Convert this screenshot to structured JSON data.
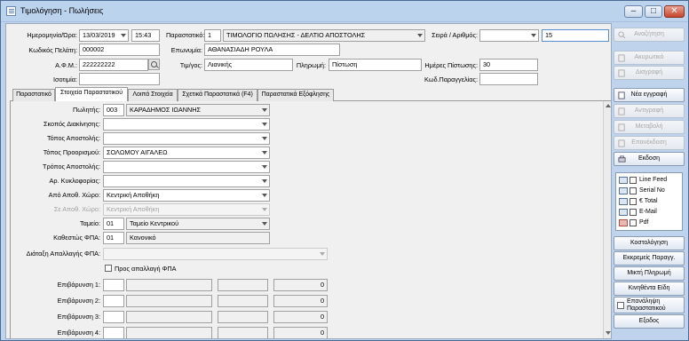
{
  "window": {
    "title": "Τιμολόγηση - Πωλήσεις"
  },
  "header": {
    "date_label": "Ημερομηνία/Ώρα:",
    "date": "13/03/2019",
    "time": "15:43",
    "doc_label": "Παραστατικό:",
    "doc_code": "1",
    "doc_name": "ΤΙΜΟΛΟΓΙΟ ΠΩΛΗΣΗΣ - ΔΕΛΤΙΟ ΑΠΟΣΤΟΛΗΣ",
    "series_label": "Σειρά / Αριθμός:",
    "series_value": "",
    "number_value": "15",
    "customer_code_label": "Κωδικός Πελάτη:",
    "customer_code": "000002",
    "name_label": "Επωνυμία:",
    "name": "ΑΘΑΝΑΣΙΑΔΗ ΡΟΥΛΑ",
    "afm_label": "Α.Φ.Μ.:",
    "afm": "222222222",
    "pricelist_label": "Τιμ/γος:",
    "pricelist": "Λιανικής",
    "payment_label": "Πληρωμή:",
    "payment": "Πίστωση",
    "credit_days_label": "Ημέρες Πίστωσης:",
    "credit_days": "30",
    "balance_label": "Ισοτιμία:",
    "balance": "",
    "order_code_label": "Κωδ.Παραγγελίας:",
    "order_code": ""
  },
  "tabs": [
    {
      "label": "Παραστατικό"
    },
    {
      "label": "Στοιχεία Παραστατικού"
    },
    {
      "label": "Λοιπά Στοιχεία"
    },
    {
      "label": "Σχετικά Παραστατικά (F4)"
    },
    {
      "label": "Παραστατικά Εξόφλησης"
    }
  ],
  "panel": {
    "salesman_label": "Πωλητής:",
    "salesman_code": "003",
    "salesman_name": "ΚΑΡΑΔΗΜΟΣ ΙΩΑΝΝΗΣ",
    "purpose_label": "Σκοπός Διακίνησης:",
    "purpose": "",
    "shipping_place_label": "Τόπος Αποστολής:",
    "shipping_place": "",
    "destination_label": "Τόπος Προορισμού:",
    "destination": "ΣΟΛΩΜΟΥ ΑΙΓΑΛΕΩ",
    "shipping_method_label": "Τρόπος Αποστολής:",
    "shipping_method": "",
    "vehicle_label": "Αρ. Κυκλοφορίας:",
    "vehicle": "",
    "from_wh_label": "Από Αποθ. Χώρο:",
    "from_wh": "Κεντρική Αποθήκη",
    "to_wh_label": "Σε Αποθ. Χώρο:",
    "to_wh": "Κεντρική Αποθήκη",
    "cash_label": "Ταμείο:",
    "cash_code": "01",
    "cash_name": "Ταμείο Κεντρικού",
    "vat_label": "Καθεστώς ΦΠΑ:",
    "vat_code": "01",
    "vat_name": "Κανονικό",
    "vat_exempt_label": "Διάταξη Απαλλαγής ΦΠΑ:",
    "vat_exempt": "",
    "vat_exempt_check_label": "Προς απαλλαγή ΦΠΑ",
    "charges": [
      {
        "label": "Επιβάρυνση 1:",
        "value": "0"
      },
      {
        "label": "Επιβάρυνση 2:",
        "value": "0"
      },
      {
        "label": "Επιβάρυνση 3:",
        "value": "0"
      },
      {
        "label": "Επιβάρυνση 4:",
        "value": "0"
      }
    ]
  },
  "sidebar": {
    "search": "Αναζήτηση",
    "cancel": "Ακυρωτικό",
    "delete": "Διαγραφή",
    "new": "Νέα εγγραφή",
    "copy": "Αντιγραφή",
    "edit": "Μεταβολή",
    "reissue": "Επανέκδοση",
    "issue": "Εκδοση",
    "options": [
      "Line Feed",
      "Serial No",
      "€ Total",
      "E-Mail",
      "Pdf"
    ],
    "costing": "Κοστολόγηση",
    "pending_orders": "Εκκρεμείς Παραγγ.",
    "mixed_payment": "Μικτή Πληρωμή",
    "moved_items": "Κινηθέντα Είδη",
    "repeat_doc": "Επανάληψη Παραστατικού",
    "exit": "Εξοδος"
  }
}
